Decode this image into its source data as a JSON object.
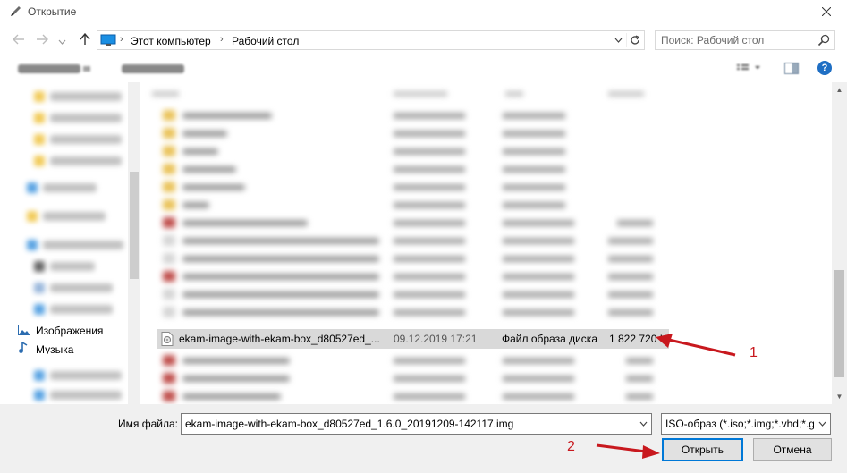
{
  "window": {
    "title": "Открытие",
    "close_icon": "close-icon",
    "title_icon": "pen-icon"
  },
  "navigation": {
    "back_icon": "back-arrow-icon",
    "forward_icon": "forward-arrow-icon",
    "recent_icon": "chevron-down-icon",
    "up_icon": "up-arrow-icon",
    "breadcrumbs": [
      "Этот компьютер",
      "Рабочий стол"
    ],
    "search_placeholder": "Поиск: Рабочий стол"
  },
  "sidebar": {
    "items": [
      {
        "label": "Изображения",
        "icon": "pictures-icon"
      },
      {
        "label": "Музыка",
        "icon": "music-icon"
      }
    ]
  },
  "file_list": {
    "selected_row": {
      "name": "ekam-image-with-ekam-box_d80527ed_...",
      "date": "09.12.2019 17:21",
      "type": "Файл образа диска",
      "size": "1 822 720 КБ",
      "icon": "disk-image-file-icon"
    }
  },
  "bottom": {
    "filename_label": "Имя файла:",
    "filename_value": "ekam-image-with-ekam-box_d80527ed_1.6.0_20191209-142117.img",
    "filter_value": "ISO-образ (*.iso;*.img;*.vhd;*.gz",
    "open_label": "Открыть",
    "cancel_label": "Отмена"
  },
  "annotations": {
    "marker_1": "1",
    "marker_2": "2",
    "color": "#c8181e"
  },
  "colors": {
    "accent": "#0078d7",
    "selection": "#d9d9d9",
    "bottom_panel": "#f0f0f0"
  }
}
